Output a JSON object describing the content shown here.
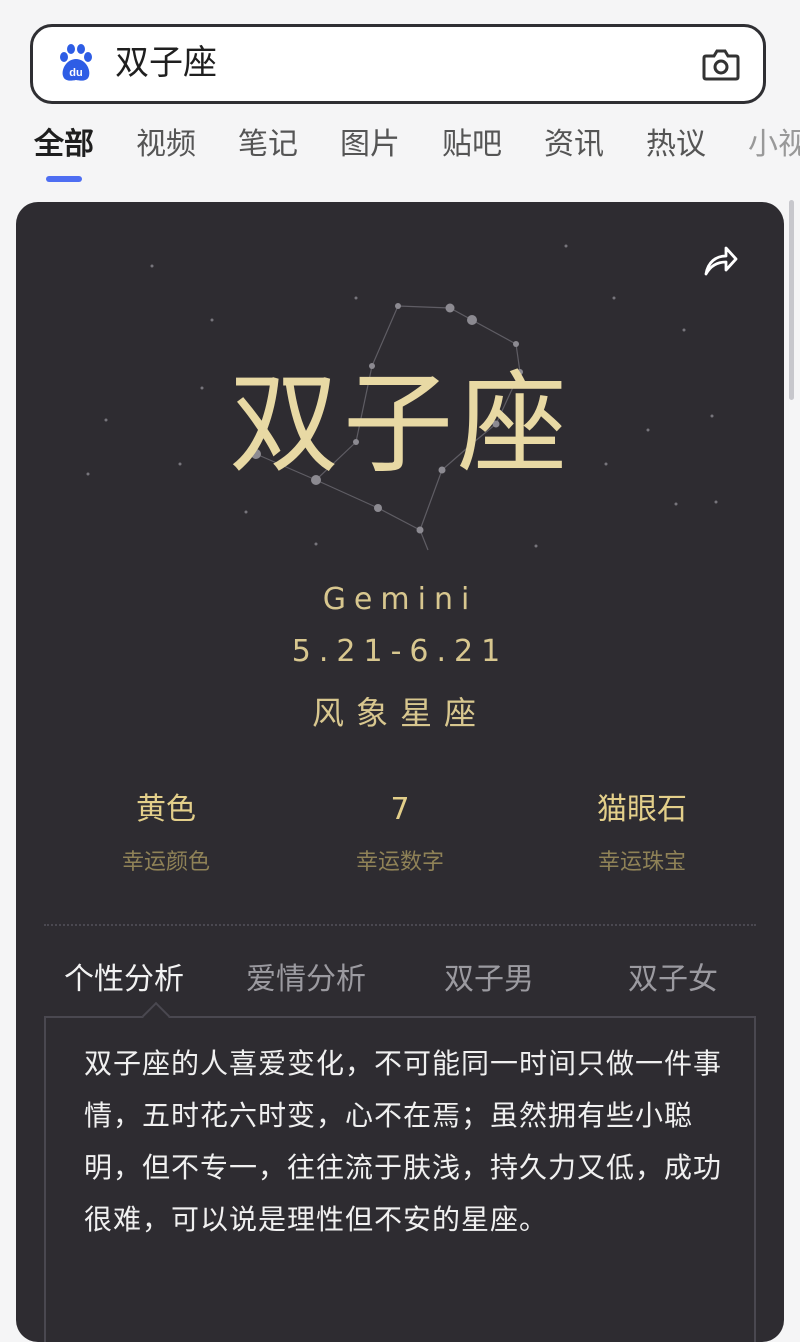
{
  "search": {
    "query": "双子座"
  },
  "tabs": [
    {
      "label": "全部",
      "active": true
    },
    {
      "label": "视频"
    },
    {
      "label": "笔记"
    },
    {
      "label": "图片"
    },
    {
      "label": "贴吧"
    },
    {
      "label": "资讯"
    },
    {
      "label": "热议"
    },
    {
      "label": "小视"
    }
  ],
  "card": {
    "title": "双子座",
    "english": "Gemini",
    "dates": "5.21-6.21",
    "element": "风象星座",
    "lucky": [
      {
        "value": "黄色",
        "label": "幸运颜色"
      },
      {
        "value": "7",
        "label": "幸运数字"
      },
      {
        "value": "猫眼石",
        "label": "幸运珠宝"
      }
    ],
    "subtabs": [
      {
        "label": "个性分析",
        "active": true
      },
      {
        "label": "爱情分析"
      },
      {
        "label": "双子男"
      },
      {
        "label": "双子女"
      }
    ],
    "description": "双子座的人喜爱变化，不可能同一时间只做一件事情，五时花六时变，心不在焉；虽然拥有些小聪明，但不专一，往往流于肤浅，持久力又低，成功很难，可以说是理性但不安的星座。"
  },
  "colors": {
    "accent": "#4e6ef2",
    "card_bg": "#2e2c31",
    "gold": "#e8d9a4"
  },
  "icons": {
    "logo": "baidu-paw-icon",
    "camera": "camera-icon",
    "share": "share-icon"
  }
}
